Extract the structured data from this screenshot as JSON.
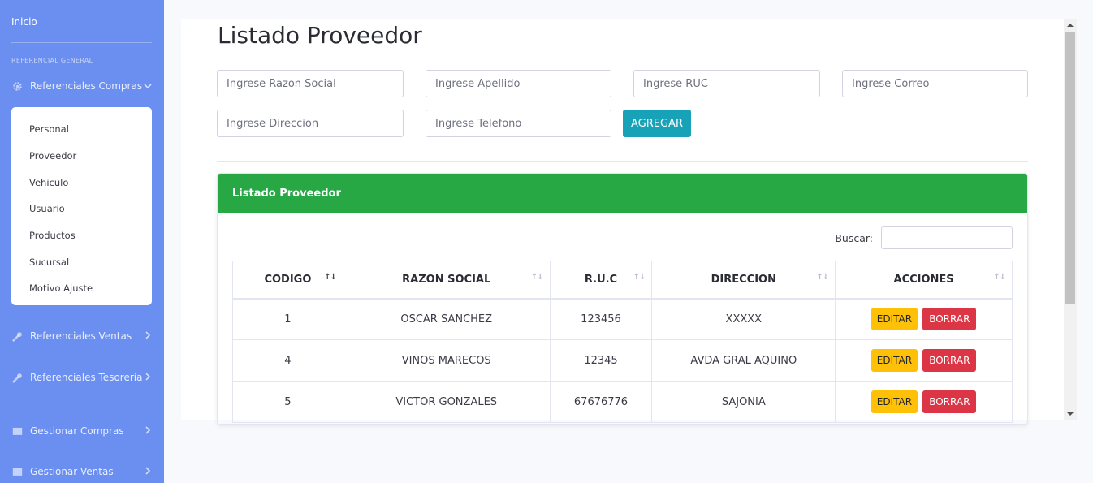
{
  "sidebar": {
    "inicio": "Inicio",
    "heading": "REFERENCIAL GENERAL",
    "compras": "Referenciales Compras",
    "submenu": [
      "Personal",
      "Proveedor",
      "Vehiculo",
      "Usuario",
      "Productos",
      "Sucursal",
      "Motivo Ajuste"
    ],
    "ventas": "Referenciales Ventas",
    "tesoreria": "Referenciales Tesorería",
    "gestionar_compras": "Gestionar Compras",
    "gestionar_ventas": "Gestionar Ventas"
  },
  "page": {
    "title": "Listado Proveedor"
  },
  "form": {
    "razon_social": "Ingrese Razon Social",
    "apellido": "Ingrese Apellido",
    "ruc": "Ingrese RUC",
    "correo": "Ingrese Correo",
    "direccion": "Ingrese Direccion",
    "telefono": "Ingrese Telefono",
    "agregar": "AGREGAR"
  },
  "table_panel": {
    "header": "Listado Proveedor",
    "search_label": "Buscar:",
    "columns": [
      "CODIGO",
      "RAZON SOCIAL",
      "R.U.C",
      "DIRECCION",
      "ACCIONES"
    ],
    "rows": [
      {
        "codigo": "1",
        "razon_social": "OSCAR SANCHEZ",
        "ruc": "123456",
        "direccion": "XXXXX"
      },
      {
        "codigo": "4",
        "razon_social": "VINOS MARECOS",
        "ruc": "12345",
        "direccion": "AVDA GRAL AQUINO"
      },
      {
        "codigo": "5",
        "razon_social": "VICTOR GONZALES",
        "ruc": "67676776",
        "direccion": "SAJONIA"
      }
    ],
    "edit_label": "EDITAR",
    "delete_label": "BORRAR"
  },
  "colors": {
    "sidebar": "#6b8ff0",
    "panel_header": "#28a745",
    "add_button": "#17a2b8",
    "edit_button": "#ffc107",
    "delete_button": "#dc3545"
  }
}
